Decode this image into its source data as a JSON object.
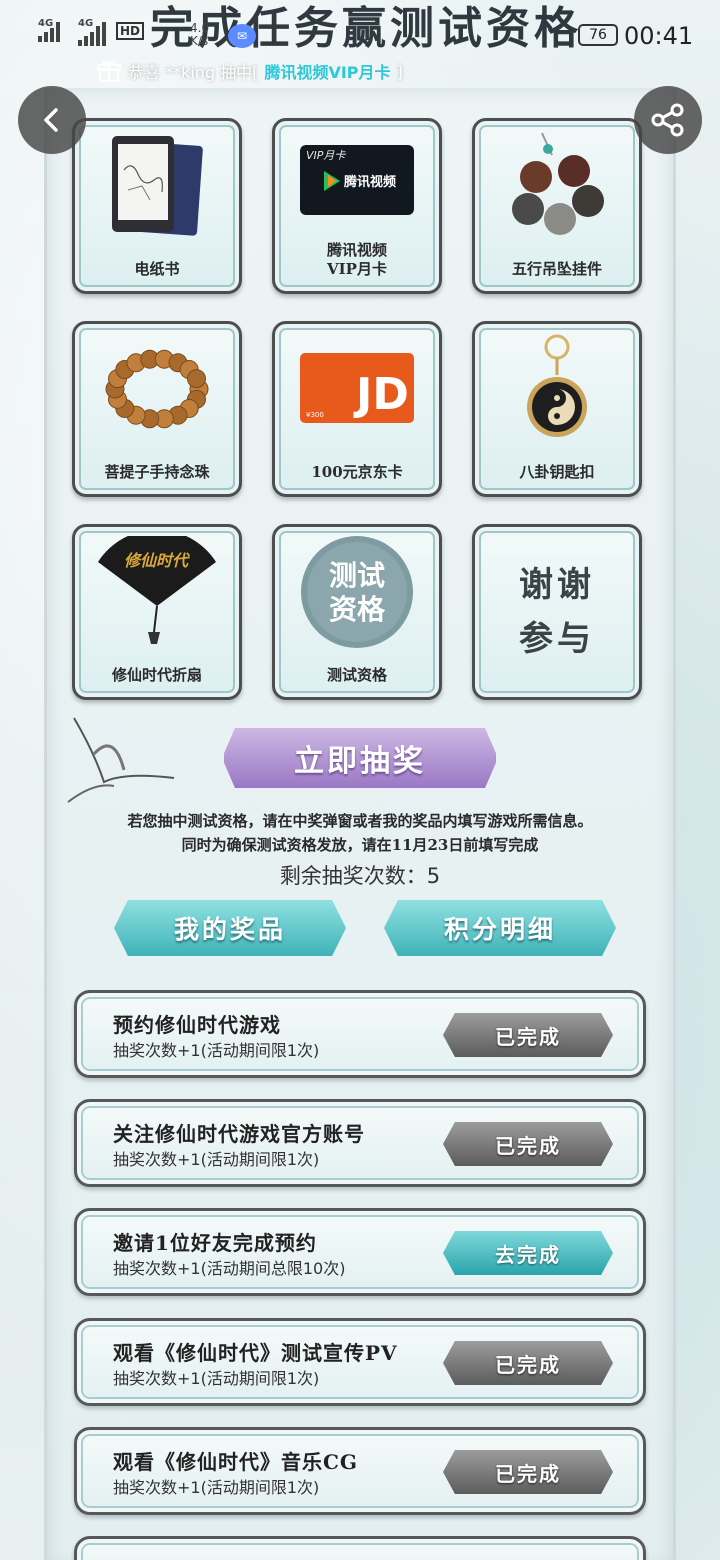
{
  "status_bar": {
    "network_1": "4G",
    "network_2": "4G",
    "hd": "HD",
    "speed_value": "4.0",
    "speed_unit": "K/s",
    "battery": "76",
    "time": "00:41"
  },
  "banner": {
    "title": "完成任务赢测试资格"
  },
  "marquee": {
    "prefix": "恭喜 **king 抽中[",
    "prize": "腾讯视频VIP月卡",
    "suffix": "]"
  },
  "prizes": [
    {
      "label": "电纸书",
      "icon": "ereader-icon"
    },
    {
      "label": "腾讯视频\nVIP月卡",
      "icon": "vip-card-icon",
      "card_text": "VIP月卡",
      "brand": "腾讯视频"
    },
    {
      "label": "五行吊坠挂件",
      "icon": "bead-pendant-icon"
    },
    {
      "label": "菩提子手持念珠",
      "icon": "prayer-beads-icon"
    },
    {
      "label": "100元京东卡",
      "icon": "jd-card-icon",
      "card_text": "JD",
      "card_value": "¥300"
    },
    {
      "label": "八卦钥匙扣",
      "icon": "bagua-keychain-icon"
    },
    {
      "label": "修仙时代折扇",
      "icon": "folding-fan-icon",
      "fan_text": "修仙时代"
    },
    {
      "label": "测试资格",
      "icon": "test-seal-icon",
      "seal_line1": "测试",
      "seal_line2": "资格"
    },
    {
      "label": "",
      "icon": "thanks-text",
      "line1": "谢谢",
      "line2": "参与"
    }
  ],
  "draw_button": "立即抽奖",
  "notice": {
    "line1": "若您抽中测试资格，请在中奖弹窗或者我的奖品内填写游戏所需信息。",
    "line2": "同时为确保测试资格发放，请在11月23日前填写完成"
  },
  "remaining": "剩余抽奖次数：5",
  "my_prizes_button": "我的奖品",
  "points_detail_button": "积分明细",
  "tasks": [
    {
      "title": "预约修仙时代游戏",
      "desc": "抽奖次数+1(活动期间限1次)",
      "status": "已完成",
      "done": true
    },
    {
      "title": "关注修仙时代游戏官方账号",
      "desc": "抽奖次数+1(活动期间限1次)",
      "status": "已完成",
      "done": true
    },
    {
      "title": "邀请1位好友完成预约",
      "desc": "抽奖次数+1(活动期间总限10次)",
      "status": "去完成",
      "done": false
    },
    {
      "title": "观看《修仙时代》测试宣传PV",
      "desc": "抽奖次数+1(活动期间限1次)",
      "status": "已完成",
      "done": true
    },
    {
      "title": "观看《修仙时代》音乐CG",
      "desc": "抽奖次数+1(活动期间限1次)",
      "status": "已完成",
      "done": true
    }
  ],
  "colors": {
    "accent_teal": "#3fb3b8",
    "accent_purple": "#9a78c4",
    "done_gray": "#6a6a6a",
    "highlight": "#2ec8d8"
  }
}
